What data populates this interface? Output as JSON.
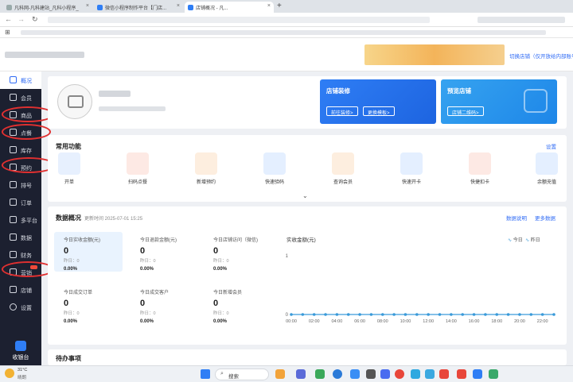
{
  "browser": {
    "tabs": [
      {
        "title": "凡科网-凡科建站_凡科小程序_"
      },
      {
        "title": "微信小程序制作平台【门店..."
      },
      {
        "title": "店铺概况 - 凡..."
      }
    ],
    "new_tab": "+"
  },
  "header": {
    "switch_store": "切换店铺（仅开放给内部账号）"
  },
  "sidebar": {
    "items": [
      {
        "label": "概况"
      },
      {
        "label": "会员"
      },
      {
        "label": "商品"
      },
      {
        "label": "点餐"
      },
      {
        "label": "库存"
      },
      {
        "label": "预约"
      },
      {
        "label": "排号"
      },
      {
        "label": "订单"
      },
      {
        "label": "多平台"
      },
      {
        "label": "数据"
      },
      {
        "label": "财务"
      },
      {
        "label": "营销"
      },
      {
        "label": "店铺"
      },
      {
        "label": "设置"
      }
    ],
    "cashier": "收银台"
  },
  "store_cards": {
    "decorate": {
      "title": "店铺装修",
      "btn1": "前往装修>",
      "btn2": "更换模板>"
    },
    "preview": {
      "title": "预览店铺",
      "btn1": "店铺二维码>"
    }
  },
  "common_functions": {
    "title": "常用功能",
    "settings": "设置",
    "items": [
      {
        "label": "开单",
        "color": "#2f7ef5"
      },
      {
        "label": "扫码点餐",
        "color": "#f56a4a"
      },
      {
        "label": "新增预约",
        "color": "#f5892f"
      },
      {
        "label": "快速验码",
        "color": "#3a8ef5"
      },
      {
        "label": "查询会员",
        "color": "#f5892f"
      },
      {
        "label": "快速开卡",
        "color": "#2f7ef5"
      },
      {
        "label": "快捷扣卡",
        "color": "#f56a4a"
      },
      {
        "label": "余额充值",
        "color": "#2f7ef5"
      }
    ]
  },
  "data_overview": {
    "title": "数据概况",
    "updated": "更新时间 2025-07-01 15:25",
    "help": "数据说明",
    "more": "更多数据",
    "metrics": [
      {
        "label": "今日实收金额(元)",
        "value": "0",
        "yesterday": "昨日：0",
        "pct": "0.00%"
      },
      {
        "label": "今日退款金额(元)",
        "value": "0",
        "yesterday": "昨日：0",
        "pct": "0.00%"
      },
      {
        "label": "今日店铺访问（微信)",
        "value": "0",
        "yesterday": "昨日：0",
        "pct": "0.00%"
      },
      {
        "label": "今日成交订单",
        "value": "0",
        "yesterday": "昨日：0",
        "pct": "0.00%"
      },
      {
        "label": "今日成交客户",
        "value": "0",
        "yesterday": "昨日：0",
        "pct": "0.00%"
      },
      {
        "label": "今日新增会员",
        "value": "0",
        "yesterday": "昨日：0",
        "pct": "0.00%"
      }
    ]
  },
  "chart_data": {
    "type": "line",
    "title": "实收金额(元)",
    "legend": [
      "今日",
      "昨日"
    ],
    "legend_position": "top-right",
    "ylim": [
      0,
      1
    ],
    "y_ticks": [
      "1",
      "0"
    ],
    "x_tick_labels": [
      "00:00",
      "02:00",
      "04:00",
      "06:00",
      "08:00",
      "10:00",
      "12:00",
      "14:00",
      "16:00",
      "18:00",
      "20:00",
      "22:00"
    ],
    "x": [
      0,
      1,
      2,
      3,
      4,
      5,
      6,
      7,
      8,
      9,
      10,
      11,
      12,
      13,
      14,
      15,
      16,
      17,
      18,
      19,
      20,
      21,
      22,
      23
    ],
    "series": [
      {
        "name": "今日",
        "values": [
          0,
          0,
          0,
          0,
          0,
          0,
          0,
          0,
          0,
          0,
          0,
          0,
          0,
          0,
          0,
          0,
          0,
          0,
          0,
          0,
          0,
          0,
          0,
          0
        ],
        "color": "#3a9ad9"
      }
    ],
    "grid": false
  },
  "todo": {
    "title": "待办事项"
  },
  "taskbar": {
    "weather_temp": "31°C",
    "weather_text": "晴朗",
    "search": "搜索"
  }
}
